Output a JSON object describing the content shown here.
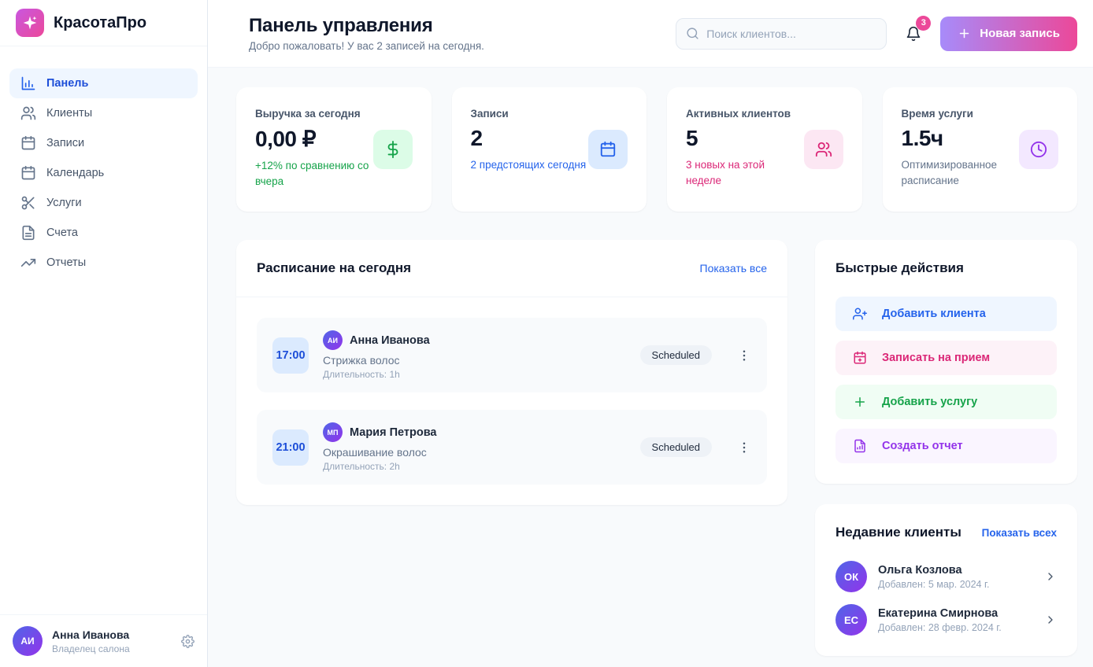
{
  "app": {
    "name": "КрасотаПро",
    "logo_icon": "sparkles-icon"
  },
  "sidebar": {
    "items": [
      {
        "label": "Панель",
        "icon": "bar-chart-icon",
        "active": true
      },
      {
        "label": "Клиенты",
        "icon": "users-icon"
      },
      {
        "label": "Записи",
        "icon": "calendar-icon"
      },
      {
        "label": "Календарь",
        "icon": "calendar-icon"
      },
      {
        "label": "Услуги",
        "icon": "scissors-icon"
      },
      {
        "label": "Счета",
        "icon": "file-text-icon"
      },
      {
        "label": "Отчеты",
        "icon": "trending-up-icon"
      }
    ],
    "user": {
      "initials": "АИ",
      "name": "Анна Иванова",
      "role": "Владелец салона",
      "settings_icon": "gear-icon"
    }
  },
  "header": {
    "title": "Панель управления",
    "subtitle": "Добро пожаловать! У вас 2 записей на сегодня.",
    "search_placeholder": "Поиск клиентов...",
    "notification_count": "3",
    "new_record_label": "Новая запись"
  },
  "stats": [
    {
      "label": "Выручка за сегодня",
      "value": "0,00 ₽",
      "sub": "+12% по сравнению со вчера",
      "icon": "dollar-icon",
      "accent": "green"
    },
    {
      "label": "Записи",
      "value": "2",
      "sub": "2 предстоящих сегодня",
      "icon": "calendar-icon",
      "accent": "blue"
    },
    {
      "label": "Активных клиентов",
      "value": "5",
      "sub": "3 новых на этой неделе",
      "icon": "users-icon",
      "accent": "pink"
    },
    {
      "label": "Время услуги",
      "value": "1.5ч",
      "sub": "Оптимизированное расписание",
      "icon": "clock-icon",
      "accent": "purple"
    }
  ],
  "schedule": {
    "title": "Расписание на сегодня",
    "show_all_label": "Показать все",
    "appointments": [
      {
        "time": "17:00",
        "initials": "АИ",
        "client": "Анна Иванова",
        "service": "Стрижка волос",
        "duration": "Длительность: 1h",
        "status": "Scheduled"
      },
      {
        "time": "21:00",
        "initials": "МП",
        "client": "Мария Петрова",
        "service": "Окрашивание волос",
        "duration": "Длительность: 2h",
        "status": "Scheduled"
      }
    ]
  },
  "quick_actions": {
    "title": "Быстрые действия",
    "actions": [
      {
        "label": "Добавить клиента",
        "icon": "user-plus-icon",
        "accent": "blue"
      },
      {
        "label": "Записать на прием",
        "icon": "calendar-plus-icon",
        "accent": "pink"
      },
      {
        "label": "Добавить услугу",
        "icon": "plus-icon",
        "accent": "green"
      },
      {
        "label": "Создать отчет",
        "icon": "file-chart-icon",
        "accent": "purple"
      }
    ]
  },
  "recent_clients": {
    "title": "Недавние клиенты",
    "show_all_label": "Показать всех",
    "clients": [
      {
        "initials": "ОК",
        "name": "Ольга Козлова",
        "added": "Добавлен: 5 мар. 2024 г."
      },
      {
        "initials": "ЕС",
        "name": "Екатерина Смирнова",
        "added": "Добавлен: 28 февр. 2024 г."
      }
    ]
  },
  "colors": {
    "accent_blue": "#2563eb",
    "accent_green": "#16a34a",
    "accent_pink": "#db2777",
    "accent_purple": "#9333ea",
    "badge_pink": "#ec4899",
    "button_gradient": [
      "#a78bfa",
      "#ec4899"
    ],
    "avatar_gradient": [
      "#4f66e8",
      "#9333ea"
    ]
  }
}
